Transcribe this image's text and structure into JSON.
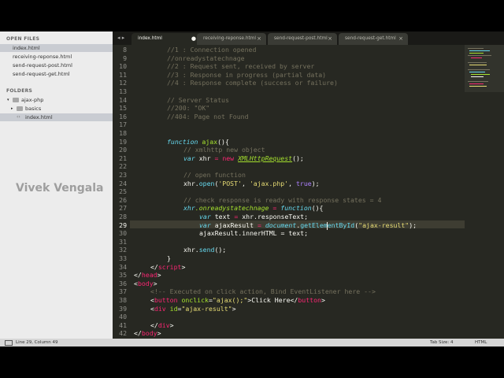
{
  "sidebar": {
    "open_files_header": "OPEN FILES",
    "open_files": [
      "index.html",
      "receiving-reponse.html",
      "send-request-post.html",
      "send-request-get.html"
    ],
    "folders_header": "FOLDERS",
    "folder_root": "ajax-php",
    "folder_sub": "basics",
    "folder_file": "index.html"
  },
  "watermark": "Vivek Vengala",
  "tabs": [
    {
      "label": "index.html",
      "close": "●"
    },
    {
      "label": "receiving-reponse.html",
      "close": "×"
    },
    {
      "label": "send-request-post.html",
      "close": "×"
    },
    {
      "label": "send-request-get.html",
      "close": "×"
    }
  ],
  "line_numbers": [
    "8",
    "9",
    "10",
    "11",
    "12",
    "13",
    "14",
    "15",
    "16",
    "17",
    "18",
    "19",
    "20",
    "21",
    "22",
    "23",
    "24",
    "25",
    "26",
    "27",
    "28",
    "29",
    "30",
    "31",
    "32",
    "33",
    "34",
    "35",
    "36",
    "37",
    "38",
    "39",
    "40",
    "41",
    "42"
  ],
  "code": {
    "l0": "//1 : Connection opened",
    "l1": "//onreadystatechnage",
    "l2": "//2 : Request sent, received by server",
    "l3": "//3 : Response in progress (partial data)",
    "l4": "//4 : Response complete (success or failure)",
    "l6": "// Server Status",
    "l7": "//200: \"OK\"",
    "l8": "//404: Page not Found",
    "l11a": "function",
    "l11b": "ajax",
    "l11c": "(){",
    "l12": "// xmlhttp new object",
    "l13a": "var",
    "l13b": " xhr ",
    "l13c": "=",
    "l13d": "new",
    "l13e": "XMLHttpRequest",
    "l13f": "();",
    "l15": "// open function",
    "l16a": "xhr.",
    "l16b": "open",
    "l16c": "(",
    "l16d": "'POST'",
    "l16e": ", ",
    "l16f": "'ajax.php'",
    "l16g": ", ",
    "l16h": "true",
    "l16i": ");",
    "l18": "// check response is ready with response states = 4",
    "l19a": "xhr",
    "l19b": ".onreadystatechnage",
    "l19c": " = ",
    "l19d": "function",
    "l19e": "(){",
    "l20a": "var",
    "l20b": " text ",
    "l20c": "=",
    "l20d": " xhr.responseText;",
    "l21a": "var",
    "l21b": " ajaxResult ",
    "l21c": "=",
    "l21d": "document",
    "l21e": ".",
    "l21f": "getElementById",
    "l21g": "(",
    "l21h": "\"ajax-result\"",
    "l21i": ");",
    "l22": "ajaxResult.innerHTML = text;",
    "l24a": "xhr.",
    "l24b": "send",
    "l24c": "();",
    "l25": "}",
    "l26a": "</",
    "l26b": "script",
    "l26c": ">",
    "l27a": "</",
    "l27b": "head",
    "l27c": ">",
    "l28a": "<",
    "l28b": "body",
    "l28c": ">",
    "l29": "<!-- Executed on click action, Bind EventListener here -->",
    "l30a": "<",
    "l30b": "button",
    "l30c": "onclick",
    "l30d": "=",
    "l30e": "\"ajax();\"",
    "l30f": ">Click Here</",
    "l30g": "button",
    "l30h": ">",
    "l31a": "<",
    "l31b": "div",
    "l31c": "id",
    "l31d": "=",
    "l31e": "\"ajax-result\"",
    "l31f": ">",
    "l33a": "</",
    "l33b": "div",
    "l33c": ">",
    "l34a": "</",
    "l34b": "body",
    "l34c": ">"
  },
  "status": {
    "position": "Line 29, Column 49",
    "tab_size": "Tab Size: 4",
    "syntax": "HTML"
  },
  "colors": {
    "editor_bg": "#272822",
    "comment": "#75715e",
    "keyword": "#66d9ef",
    "function": "#a6e22e",
    "operator": "#f92672",
    "string": "#e6db74"
  }
}
